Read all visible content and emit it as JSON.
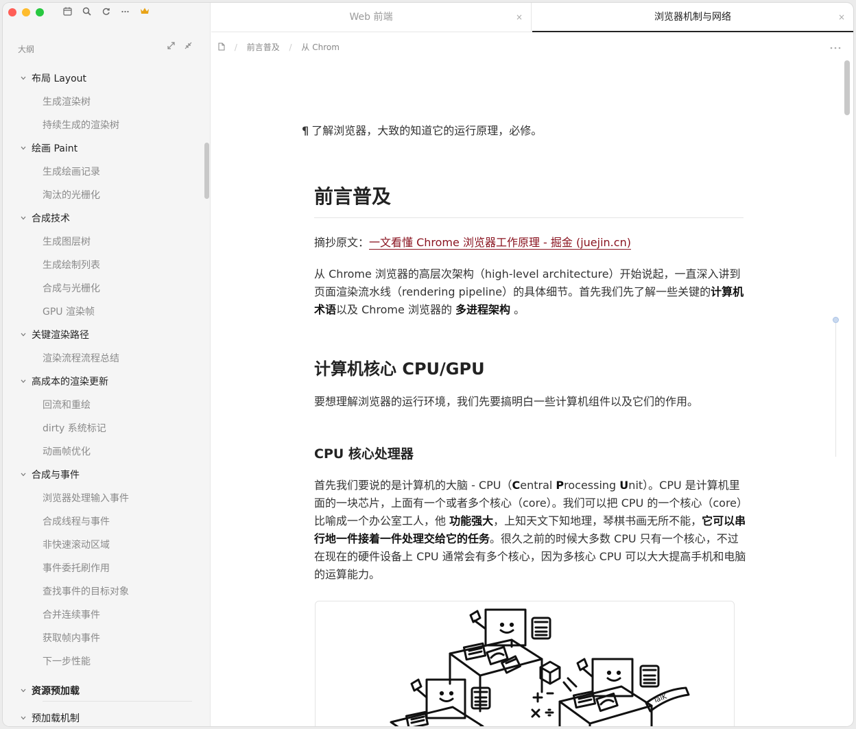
{
  "sidebar": {
    "outline_label": "大纲",
    "items": [
      {
        "label": "布局 Layout",
        "level": 1
      },
      {
        "label": "生成渲染树",
        "level": 2
      },
      {
        "label": "持续生成的渲染树",
        "level": 2
      },
      {
        "label": "绘画 Paint",
        "level": 1
      },
      {
        "label": "生成绘画记录",
        "level": 2
      },
      {
        "label": "淘汰的光栅化",
        "level": 2
      },
      {
        "label": "合成技术",
        "level": 1
      },
      {
        "label": "生成图层树",
        "level": 2
      },
      {
        "label": "生成绘制列表",
        "level": 2
      },
      {
        "label": "合成与光栅化",
        "level": 2
      },
      {
        "label": "GPU 渲染帧",
        "level": 2
      },
      {
        "label": "关键渲染路径",
        "level": 1
      },
      {
        "label": "渲染流程流程总结",
        "level": 2
      },
      {
        "label": "高成本的渲染更新",
        "level": 1
      },
      {
        "label": "回流和重绘",
        "level": 2
      },
      {
        "label": "dirty 系统标记",
        "level": 2
      },
      {
        "label": "动画帧优化",
        "level": 2
      },
      {
        "label": "合成与事件",
        "level": 1
      },
      {
        "label": "浏览器处理输入事件",
        "level": 2
      },
      {
        "label": "合成线程与事件",
        "level": 2
      },
      {
        "label": "非快速滚动区域",
        "level": 2
      },
      {
        "label": "事件委托刷作用",
        "level": 2
      },
      {
        "label": "查找事件的目标对象",
        "level": 2
      },
      {
        "label": "合并连续事件",
        "level": 2
      },
      {
        "label": "获取帧内事件",
        "level": 2
      },
      {
        "label": "下一步性能",
        "level": 2
      },
      {
        "label": "资源预加载",
        "level": 0
      },
      {
        "label": "预加载机制",
        "level": 1
      }
    ]
  },
  "tabs": [
    {
      "label": "Web 前端",
      "close": "×"
    },
    {
      "label": "浏览器机制与网络",
      "close": "×"
    }
  ],
  "breadcrumb": {
    "sep": "/",
    "items": [
      "前言普及",
      "从 Chrom"
    ]
  },
  "doc": {
    "intro_mark": "¶",
    "intro": "了解浏览器，大致的知道它的运行原理，必修。",
    "h1": "前言普及",
    "source_label": "摘抄原文：",
    "source_link": "一文看懂 Chrome 浏览器工作原理 - 掘金 (juejin.cn)",
    "p1_a": "从 Chrome 浏览器的高层次架构（high-level architecture）开始说起，一直深入讲到页面渲染流水线（rendering pipeline）的具体细节。首先我们先了解一些关键的",
    "p1_b1": "计算机术语",
    "p1_c": "以及 Chrome 浏览器的 ",
    "p1_b2": "多进程架构",
    "p1_d": " 。",
    "h2": "计算机核心 CPU/GPU",
    "p2": "要想理解浏览器的运行环境，我们先要搞明白一些计算机组件以及它们的作用。",
    "h3": "CPU 核心处理器",
    "p3_a": "首先我们要说的是计算机的大脑 - CPU（",
    "p3_C": "C",
    "p3_entral": "entral ",
    "p3_P": "P",
    "p3_rocessing": "rocessing ",
    "p3_U": "U",
    "p3_nit": "nit）。CPU 是计算机里面的一块芯片，上面有一个或者多个核心（core）。我们可以把 CPU 的一个核心（core）比喻成一个办公室工人，他 ",
    "p3_b1": "功能强大",
    "p3_mid": "，上知天文下知地理，琴棋书画无所不能，",
    "p3_b2": "它可以串行地一件接着一件处理交给它的任务",
    "p3_end": "。很久之前的时候大多数 CPU 只有一个核心，不过在现在的硬件设备上 CPU 通常会有多个核心，因为多核心 CPU 可以大大提高手机和电脑的运算能力。"
  },
  "colors": {
    "link": "#8a1420",
    "light_red": "#ff5f57",
    "light_yellow": "#febc2e",
    "light_green": "#28c840",
    "crown": "#e8a317"
  }
}
